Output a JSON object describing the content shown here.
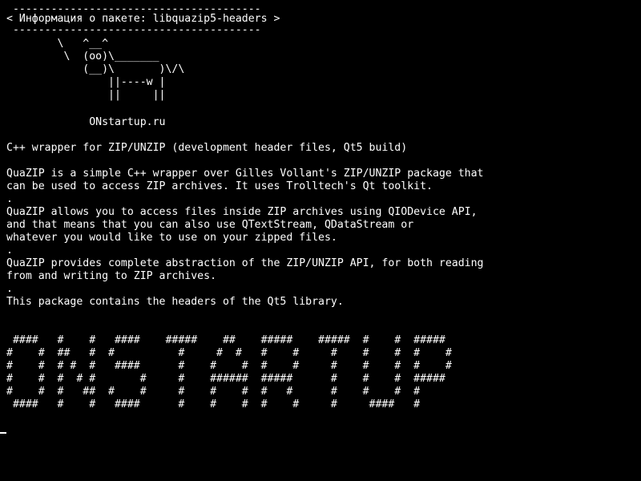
{
  "terminal": {
    "fg": "#ffffff",
    "bg": "#000000",
    "cowsay": {
      "top_border": " ---------------------------------------",
      "message": "< Информация о пакете: libquazip5-headers >",
      "bottom_border": " ---------------------------------------",
      "cow": [
        "        \\   ^__^",
        "         \\  (oo)\\_______",
        "            (__)\\       )\\/\\",
        "                ||----w |",
        "                ||     ||"
      ],
      "credit": "             ONstartup.ru"
    },
    "summary": "C++ wrapper for ZIP/UNZIP (development header files, Qt5 build)",
    "description": [
      "QuaZIP is a simple C++ wrapper over Gilles Vollant's ZIP/UNZIP package that",
      "can be used to access ZIP archives. It uses Trolltech's Qt toolkit.",
      ".",
      "QuaZIP allows you to access files inside ZIP archives using QIODevice API,",
      "and that means that you can also use QTextStream, QDataStream or",
      "whatever you would like to use on your zipped files.",
      ".",
      "QuaZIP provides complete abstraction of the ZIP/UNZIP API, for both reading",
      "from and writing to ZIP archives.",
      ".",
      "This package contains the headers of the Qt5 library."
    ],
    "banner": [
      " ####   #    #   ####    #####    ##    #####    #####  #    #  #####",
      "#    #  ##   #  #          #     #  #   #    #     #    #    #  #    #",
      "#    #  # #  #   ####      #    #    #  #    #     #    #    #  #    #",
      "#    #  #  # #       #     #    ######  #####      #    #    #  #####",
      "#    #  #   ##  #    #     #    #    #  #   #      #    #    #  #",
      " ####   #    #   ####      #    #    #  #    #     #     ####   #"
    ]
  }
}
